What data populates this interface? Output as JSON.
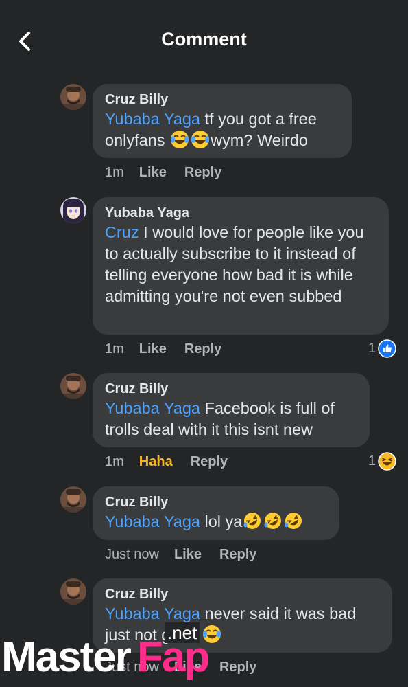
{
  "header": {
    "title": "Comment",
    "back_icon": "chevron-left-icon"
  },
  "colors": {
    "background": "#242526",
    "bubble": "#3a3b3c",
    "mention": "#4da3ff",
    "haha": "#f7b928",
    "like_blue": "#1877f2",
    "watermark_accent": "#ff2d8a"
  },
  "comments": [
    {
      "author": "Cruz Billy",
      "mention": "Yubaba Yaga",
      "text_before_emoji": " tf you got a free onlyfans ",
      "emojis": [
        "joy-emoji",
        "joy-emoji"
      ],
      "text_after_emoji": "wym? Weirdo",
      "time": "1m",
      "like_label": "Like",
      "reply_label": "Reply"
    },
    {
      "author": "Yubaba Yaga",
      "mention": "Cruz",
      "text": " I would love for people like you to actually subscribe to it instead of telling everyone how bad it is while admitting you're not even subbed",
      "time": "1m",
      "like_label": "Like",
      "reply_label": "Reply",
      "reaction_count": "1",
      "reaction_icon": "thumbs-up-reaction-icon"
    },
    {
      "author": "Cruz Billy",
      "mention": "Yubaba Yaga",
      "text": " Facebook is full of trolls deal with it this isnt new",
      "time": "1m",
      "like_label": "Haha",
      "reply_label": "Reply",
      "reaction_count": "1",
      "reaction_icon": "haha-reaction-icon"
    },
    {
      "author": "Cruz Billy",
      "mention": "Yubaba Yaga",
      "text": " lol ya",
      "emojis": [
        "rofl-emoji",
        "rofl-emoji",
        "rofl-emoji"
      ],
      "time": "Just now",
      "like_label": "Like",
      "reply_label": "Reply"
    },
    {
      "author": "Cruz Billy",
      "mention": "Yubaba Yaga",
      "text": " never said it was bad just not good ",
      "emojis": [
        "joy-emoji"
      ],
      "time": "Just now",
      "like_label": "Like",
      "reply_label": "Reply"
    }
  ],
  "watermark": {
    "part1": "Master",
    "part2": "Fap",
    "suffix": ".net"
  }
}
